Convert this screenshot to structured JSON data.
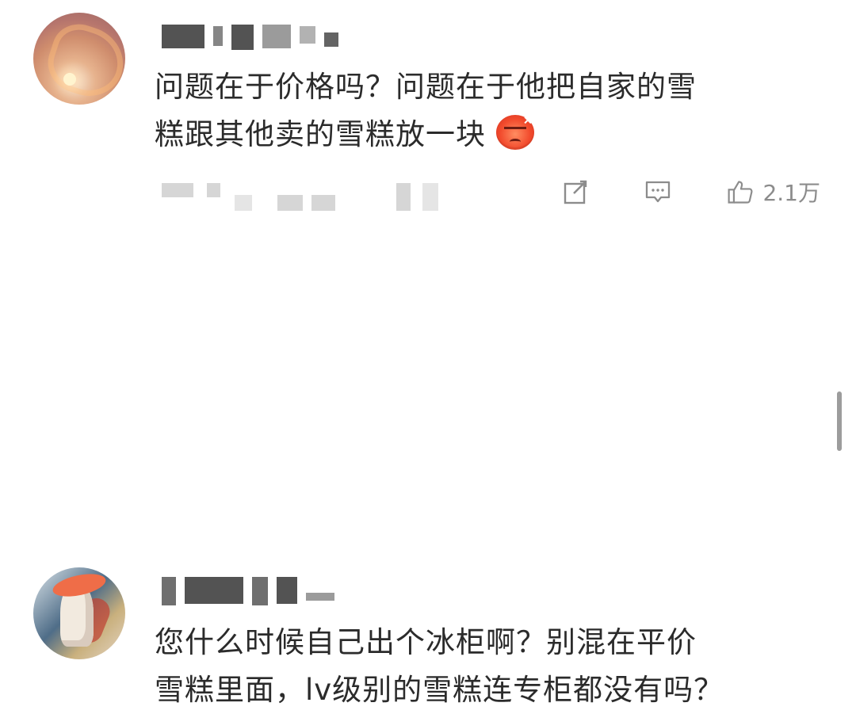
{
  "comments": [
    {
      "text_lines": [
        "问题在于价格吗？问题在于他把自家的雪",
        "糕跟其他卖的雪糕放一块"
      ],
      "emoji": "angry-face-icon",
      "like_count": "2.1万"
    },
    {
      "text_lines": [
        "您什么时候自己出个冰柜啊？别混在平价",
        "雪糕里面，lv级别的雪糕连专柜都没有吗？"
      ]
    }
  ],
  "icons": {
    "edit": "edit-icon",
    "reply": "reply-icon",
    "like": "like-icon"
  },
  "colors": {
    "text": "#2b2b2b",
    "meta_text": "#8c8c8c",
    "emoji_red": "#f24b2d",
    "scrollbar": "#9c9c9c"
  }
}
